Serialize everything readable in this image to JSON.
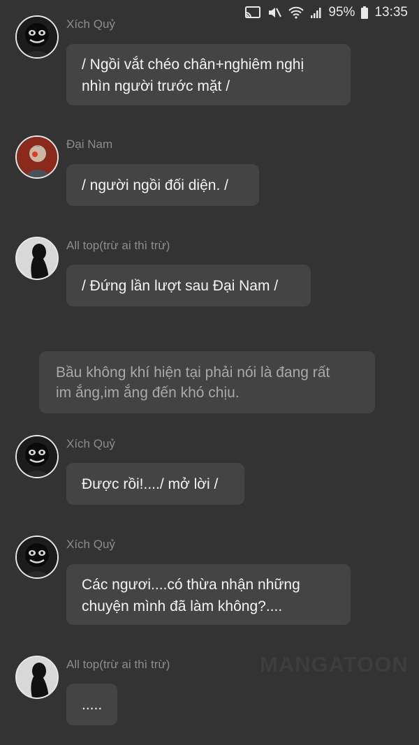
{
  "status_bar": {
    "battery": "95%",
    "time": "13:35",
    "icons": [
      "cast-icon",
      "mute-icon",
      "wifi-icon",
      "signal-icon",
      "battery-icon"
    ]
  },
  "messages": [
    {
      "name": "Xích Quỷ",
      "text_lines": [
        "/ Ngồi vắt chéo chân+nghiêm nghị",
        "nhìn người trước mặt /"
      ],
      "avatar": "dark-grinning-face"
    },
    {
      "name": "Đại Nam",
      "text_lines": [
        "/ người ngồi đối diện. /"
      ],
      "avatar": "red-background-character"
    },
    {
      "name": "All top(trừ ai thì trừ)",
      "text_lines": [
        "/ Đứng lần lượt sau Đại Nam /"
      ],
      "avatar": "silhouette"
    },
    {
      "name": "Xích Quỷ",
      "text_lines": [
        "Được rồi!..../ mở lời /"
      ],
      "avatar": "dark-grinning-face"
    },
    {
      "name": "Xích Quỷ",
      "text_lines": [
        "Các ngươi....có thừa nhận những",
        "chuyện mình đã làm không?...."
      ],
      "avatar": "dark-grinning-face"
    },
    {
      "name": "All top(trừ ai thì trừ)",
      "text_lines": [
        "....."
      ],
      "avatar": "silhouette"
    }
  ],
  "narration": {
    "lines": [
      "Bầu không khí hiện tại phải nói là đang rất",
      "im ắng,im ắng đến khó chịu."
    ]
  },
  "watermark": "MANGATOON"
}
